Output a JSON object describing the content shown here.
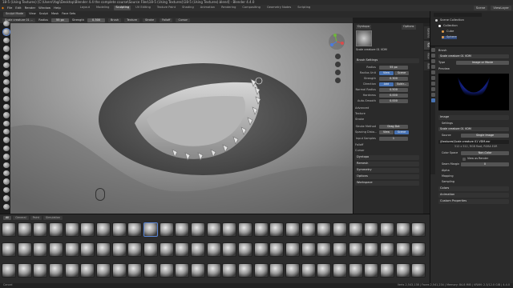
{
  "window_title": "18-5 (Using Textures) [C:\\Users\\Yogi\\Desktop\\Blender 4.4 the complete course\\Source Files\\18-5 (Using Textures)\\18-5 (Using Textures).blend] - Blender 4.4.0",
  "menu": [
    "File",
    "Edit",
    "Render",
    "Window",
    "Help"
  ],
  "workspaces": [
    "Layout",
    "Modeling",
    "Sculpting",
    "UV Editing",
    "Texture Paint",
    "Shading",
    "Animation",
    "Rendering",
    "Compositing",
    "Geometry Nodes",
    "Scripting"
  ],
  "active_workspace": "Sculpting",
  "scene": {
    "scene_label": "Scene",
    "view_layer": "ViewLayer"
  },
  "header": {
    "mode": "Sculpt Mode",
    "view": "View",
    "sculpt": "Sculpt",
    "mask": "Mask",
    "face_sets": "Face Sets",
    "brush_name": "Scale creature 01 ...",
    "radius_label": "Radius",
    "radius_value": "55 px",
    "strength_label": "Strength",
    "strength_value": "0.300",
    "brush": "Brush",
    "texture": "Texture",
    "stroke": "Stroke",
    "falloff": "Falloff",
    "cursor": "Cursor"
  },
  "sidebar": {
    "tabs": [
      "Options",
      "Tool",
      "View",
      "Item"
    ],
    "brush_caption": "Scale creature 01 VDM",
    "dyntopo": "Dyntopo",
    "options": "Options",
    "brush_settings": "Brush Settings",
    "radius_label": "Radius",
    "radius_value": "55 px",
    "radius_unit_label": "Radius Unit",
    "radius_unit_view": "View",
    "radius_unit_scene": "Scene",
    "strength_label": "Strength",
    "strength_value": "0.300",
    "direction_label": "Direction",
    "direction_add": "Add",
    "direction_sub": "Subtr...",
    "normal_radius_label": "Normal Radius",
    "normal_radius_value": "0.500",
    "hardness_label": "Hardness",
    "hardness_value": "0.000",
    "auto_smooth_label": "Auto-Smooth",
    "auto_smooth_value": "0.000",
    "advanced": "Advanced",
    "texture": "Texture",
    "stroke": "Stroke",
    "stroke_method_label": "Stroke Method",
    "stroke_method_value": "Drag Dot",
    "spacing_label": "Spacing Dista...",
    "spacing_view": "View",
    "spacing_scene": "Scene",
    "input_samples_label": "Input Samples",
    "input_samples_value": "1",
    "falloff": "Falloff",
    "cursor": "Cursor",
    "dyntopo2": "Dyntopo",
    "remesh": "Remesh",
    "symmetry": "Symmetry",
    "options2": "Options",
    "workspace": "Workspace"
  },
  "outliner": {
    "search_placeholder": "",
    "rows": [
      "Scene Collection",
      "Collection",
      "Cube",
      "Sphere"
    ]
  },
  "properties": {
    "brush_label": "Brush",
    "brush_value": "Scale creature 01 VDM",
    "type_label": "Type",
    "type_value": "Image or Movie",
    "preview": "Preview",
    "image": "Image",
    "settings": "Settings",
    "image_name": "Scale creature 01 VDM",
    "source_label": "Source",
    "source_value": "Single Image",
    "filepath": "//textures\\Scale creature 01 VDM.exr",
    "info": "512 x 512, RGB float, RGBA EXR",
    "color_space_label": "Color Space",
    "color_space_value": "Non-Color",
    "view_as_render": "View as Render",
    "seam_margin_label": "Seam Margin",
    "seam_margin_value": "0",
    "alpha": "Alpha",
    "mapping": "Mapping",
    "sampling": "Sampling",
    "colors": "Colors",
    "animation": "Animation",
    "custom_properties": "Custom Properties"
  },
  "brush_asset_tabs": [
    "All",
    "General",
    "Paint",
    "Simulation"
  ],
  "status": {
    "left": "Cancel",
    "right": "Verts 2,543,138 | Faces 2,541,234 | Memory: 84.8 MiB | VRAM: 2.3/12.0 GiB | 4.4.0"
  },
  "accent": "#4772b3"
}
